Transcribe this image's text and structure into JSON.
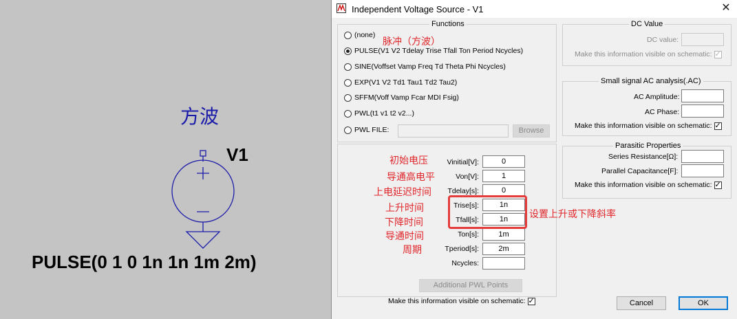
{
  "schematic": {
    "cn_label": "方波",
    "component_name": "V1",
    "component_value": "PULSE(0 1 0 1n 1n 1m 2m)",
    "symbol_plus": "+",
    "symbol_minus": "−"
  },
  "dialog": {
    "title": "Independent Voltage Source - V1",
    "close_icon": "close-icon",
    "functions": {
      "title": "Functions",
      "options": [
        {
          "label": "(none)",
          "selected": false
        },
        {
          "label": "PULSE(V1 V2 Tdelay Trise Tfall Ton Period Ncycles)",
          "selected": true
        },
        {
          "label": "SINE(Voffset Vamp Freq Td Theta Phi Ncycles)",
          "selected": false
        },
        {
          "label": "EXP(V1 V2 Td1 Tau1 Td2 Tau2)",
          "selected": false
        },
        {
          "label": "SFFM(Voff Vamp Fcar MDI Fsig)",
          "selected": false
        },
        {
          "label": "PWL(t1 v1 t2 v2...)",
          "selected": false
        },
        {
          "label": "PWL FILE:",
          "selected": false
        }
      ],
      "browse_label": "Browse",
      "pwl_file_value": ""
    },
    "params": [
      {
        "label": "Vinitial[V]:",
        "value": "0"
      },
      {
        "label": "Von[V]:",
        "value": "1"
      },
      {
        "label": "Tdelay[s]:",
        "value": "0"
      },
      {
        "label": "Trise[s]:",
        "value": "1n"
      },
      {
        "label": "Tfall[s]:",
        "value": "1n"
      },
      {
        "label": "Ton[s]:",
        "value": "1m"
      },
      {
        "label": "Tperiod[s]:",
        "value": "2m"
      },
      {
        "label": "Ncycles:",
        "value": ""
      }
    ],
    "additional_pwl_label": "Additional PWL Points",
    "visible_on_schematic_label": "Make this information visible on schematic:",
    "dc_value": {
      "title": "DC Value",
      "dc_label": "DC value:",
      "dc_value": "",
      "visible_label": "Make this information visible on schematic:"
    },
    "ac_analysis": {
      "title": "Small signal AC analysis(.AC)",
      "amplitude_label": "AC Amplitude:",
      "amplitude_value": "",
      "phase_label": "AC Phase:",
      "phase_value": "",
      "visible_label": "Make this information visible on schematic:"
    },
    "parasitic": {
      "title": "Parasitic Properties",
      "series_label": "Series Resistance[Ω]:",
      "series_value": "",
      "parallel_label": "Parallel Capacitance[F]:",
      "parallel_value": "",
      "visible_label": "Make this information visible on schematic:"
    },
    "cancel_label": "Cancel",
    "ok_label": "OK"
  },
  "annotations": {
    "pulse": "脉冲（方波）",
    "vinitial": "初始电压",
    "von": "导通高电平",
    "tdelay": "上电延迟时间",
    "trise": "上升时间",
    "tfall": "下降时间",
    "ton": "导通时间",
    "tperiod": "周期",
    "slope": "设置上升或下降斜率"
  },
  "colors": {
    "annotation": "#e0262a",
    "schematic_bg": "#c4c4c4",
    "schematic_symbol": "#1b1baa",
    "dialog_bg": "#f0f0f0",
    "highlight": "#e43b3b",
    "default_button_border": "#0078d7"
  }
}
